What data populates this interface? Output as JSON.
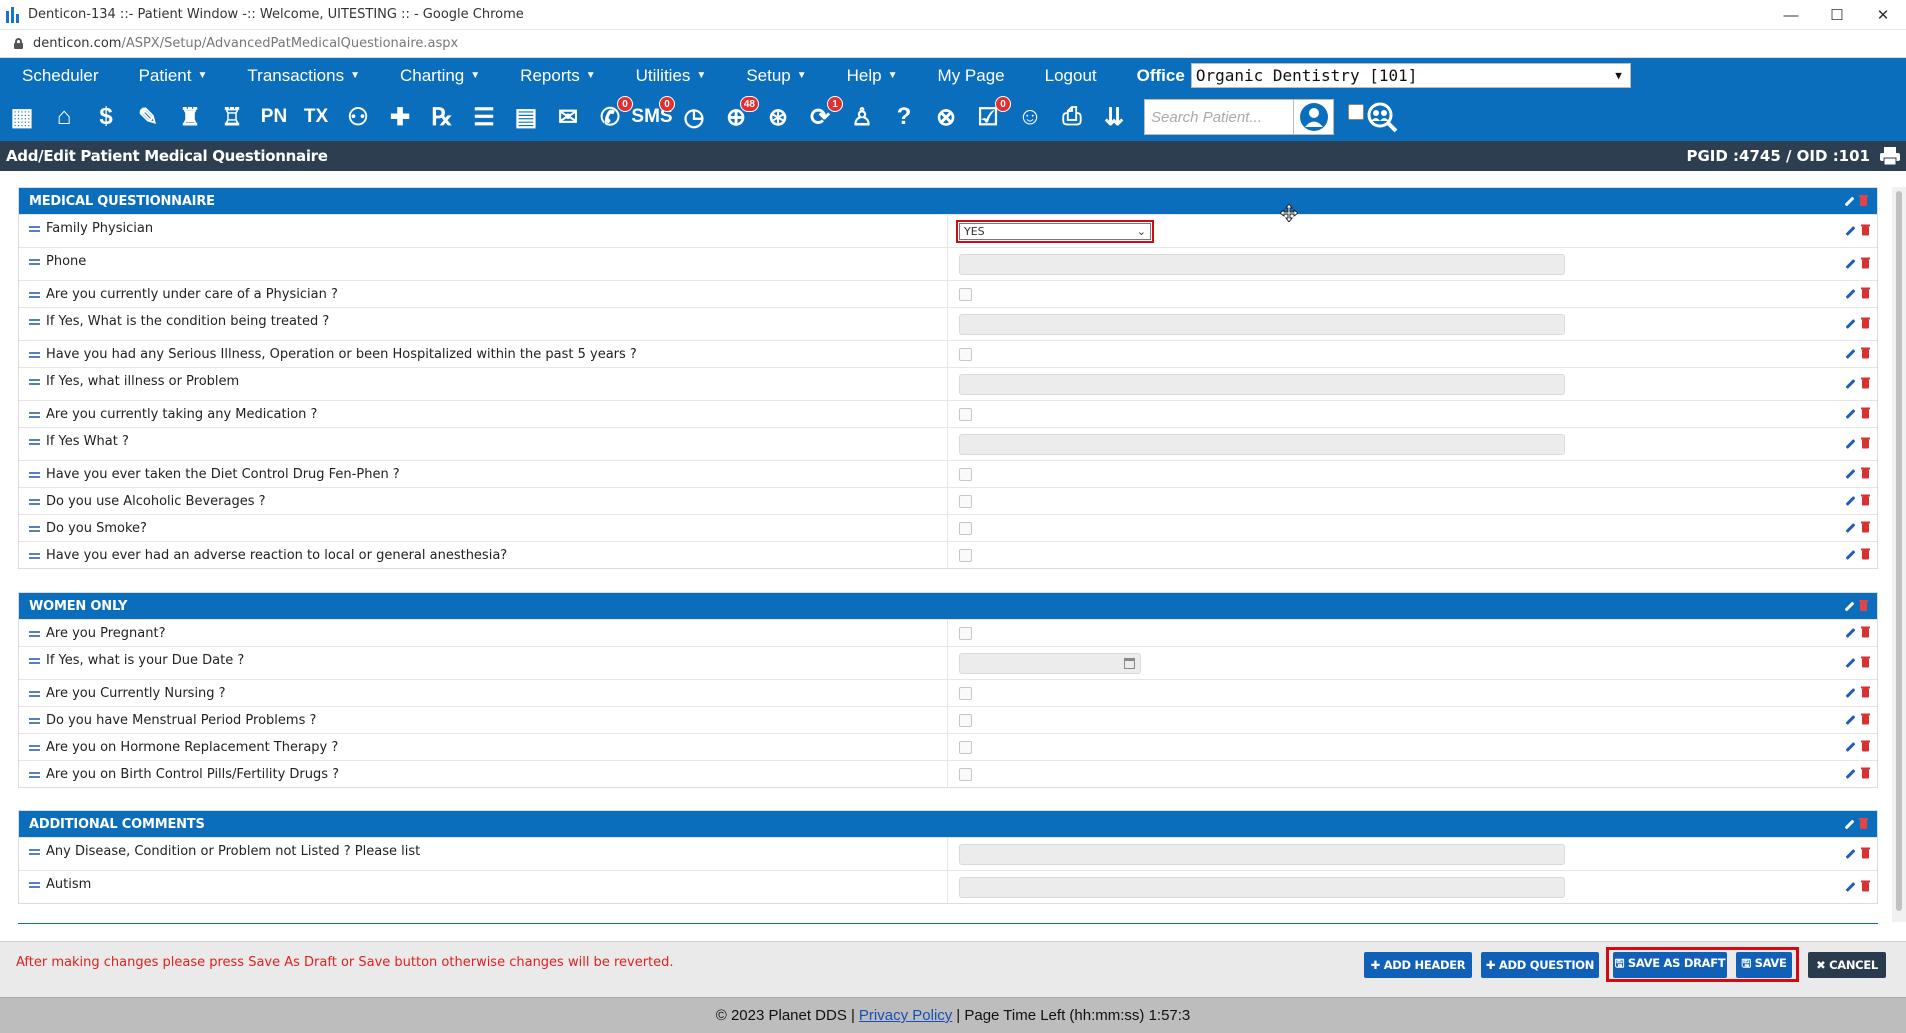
{
  "window": {
    "title": "Denticon-134 ::- Patient Window -:: Welcome, UITESTING :: - Google Chrome",
    "minimize": "—",
    "maximize": "☐",
    "close": "✕"
  },
  "address": {
    "host": "denticon.com",
    "path": "/ASPX/Setup/AdvancedPatMedicalQuestionaire.aspx"
  },
  "menu": {
    "items": [
      {
        "label": "Scheduler",
        "caret": ""
      },
      {
        "label": "Patient",
        "caret": "▼"
      },
      {
        "label": "Transactions",
        "caret": "▼"
      },
      {
        "label": "Charting",
        "caret": "▼"
      },
      {
        "label": "Reports",
        "caret": "▼"
      },
      {
        "label": "Utilities",
        "caret": "▼"
      },
      {
        "label": "Setup",
        "caret": "▼"
      },
      {
        "label": "Help",
        "caret": "▼"
      },
      {
        "label": "My Page",
        "caret": ""
      },
      {
        "label": "Logout",
        "caret": ""
      }
    ],
    "office_label": "Office",
    "office_value": "Organic Dentistry [101]"
  },
  "toolbar": {
    "search_placeholder": "Search Patient...",
    "icons": [
      {
        "name": "calendar-icon",
        "glyph": "▦"
      },
      {
        "name": "home-icon",
        "glyph": "⌂"
      },
      {
        "name": "dollar-icon",
        "glyph": "$"
      },
      {
        "name": "chart-pen-icon",
        "glyph": "✎"
      },
      {
        "name": "tooth-chart-icon",
        "glyph": "♜"
      },
      {
        "name": "tooth-icon",
        "glyph": "♖"
      },
      {
        "name": "pn-icon",
        "glyph": "PN"
      },
      {
        "name": "tx-icon",
        "glyph": "TX"
      },
      {
        "name": "add-patient-icon",
        "glyph": "⚇"
      },
      {
        "name": "add-medical-icon",
        "glyph": "✚"
      },
      {
        "name": "rx-icon",
        "glyph": "℞"
      },
      {
        "name": "notes-icon",
        "glyph": "☰"
      },
      {
        "name": "document-icon",
        "glyph": "▤"
      },
      {
        "name": "envelope-icon",
        "glyph": "✉"
      },
      {
        "name": "message-icon",
        "glyph": "✆",
        "badge": "0"
      },
      {
        "name": "sms-icon",
        "glyph": "SMS",
        "badge": "0"
      },
      {
        "name": "clock-icon",
        "glyph": "◷"
      },
      {
        "name": "globe-icon",
        "glyph": "⊕",
        "badge": "48"
      },
      {
        "name": "support-icon",
        "glyph": "⊛"
      },
      {
        "name": "alert-icon",
        "glyph": "⟳",
        "badge": "1"
      },
      {
        "name": "tooth-outline-icon",
        "glyph": "♙"
      },
      {
        "name": "help-tooth-icon",
        "glyph": "?"
      },
      {
        "name": "web-icon",
        "glyph": "⊗"
      },
      {
        "name": "checklist-icon",
        "glyph": "☑",
        "badge": "0"
      },
      {
        "name": "family-icon",
        "glyph": "☺"
      },
      {
        "name": "printer-icon",
        "glyph": "⎙"
      },
      {
        "name": "chevrons-down-icon",
        "glyph": "⇊"
      }
    ]
  },
  "page": {
    "title": "Add/Edit Patient Medical Questionnaire",
    "pgid": "PGID :4745  /  OID :101"
  },
  "sections": [
    {
      "title": "MEDICAL QUESTIONNAIRE",
      "rows": [
        {
          "label": "Family Physician",
          "type": "select",
          "value": "YES"
        },
        {
          "label": "Phone",
          "type": "text"
        },
        {
          "label": "Are you currently under care of a Physician ?",
          "type": "checkbox"
        },
        {
          "label": "If Yes, What is the condition being treated ?",
          "type": "text"
        },
        {
          "label": "Have you had any Serious Illness, Operation or been Hospitalized within the past 5 years ?",
          "type": "checkbox"
        },
        {
          "label": "If Yes, what illness or Problem",
          "type": "text"
        },
        {
          "label": "Are you currently taking any Medication ?",
          "type": "checkbox"
        },
        {
          "label": "If Yes What ?",
          "type": "text"
        },
        {
          "label": "Have you ever taken the Diet Control Drug Fen-Phen ?",
          "type": "checkbox"
        },
        {
          "label": "Do you use Alcoholic Beverages ?",
          "type": "checkbox"
        },
        {
          "label": "Do you Smoke?",
          "type": "checkbox"
        },
        {
          "label": "Have you ever had an adverse reaction to local or general anesthesia?",
          "type": "checkbox"
        }
      ]
    },
    {
      "title": "WOMEN ONLY",
      "rows": [
        {
          "label": "Are you Pregnant?",
          "type": "checkbox"
        },
        {
          "label": "If Yes, what is your Due Date ?",
          "type": "date"
        },
        {
          "label": "Are you Currently Nursing ?",
          "type": "checkbox"
        },
        {
          "label": "Do you have Menstrual Period Problems ?",
          "type": "checkbox"
        },
        {
          "label": "Are you on Hormone Replacement Therapy ?",
          "type": "checkbox"
        },
        {
          "label": "Are you on Birth Control Pills/Fertility Drugs ?",
          "type": "checkbox"
        }
      ]
    },
    {
      "title": "ADDITIONAL COMMENTS",
      "rows": [
        {
          "label": "Any Disease, Condition or Problem not Listed ? Please list",
          "type": "text"
        },
        {
          "label": "Autism",
          "type": "text"
        }
      ]
    }
  ],
  "bottom": {
    "message": "After making changes please press Save As Draft or Save button otherwise changes will be reverted.",
    "add_header": "✚ ADD HEADER",
    "add_question": "✚ ADD QUESTION",
    "save_draft": "🖫 SAVE AS DRAFT",
    "save": "🖫 SAVE",
    "cancel": "✖ CANCEL"
  },
  "footer": {
    "copyright": "© 2023 Planet DDS |",
    "privacy": "Privacy Policy",
    "time_left": "|  Page Time Left (hh:mm:ss) 1:57:3"
  },
  "colors": {
    "brand_blue": "#0a6ebd",
    "header_dark": "#2d3e50",
    "highlight_red": "#d10b10"
  }
}
